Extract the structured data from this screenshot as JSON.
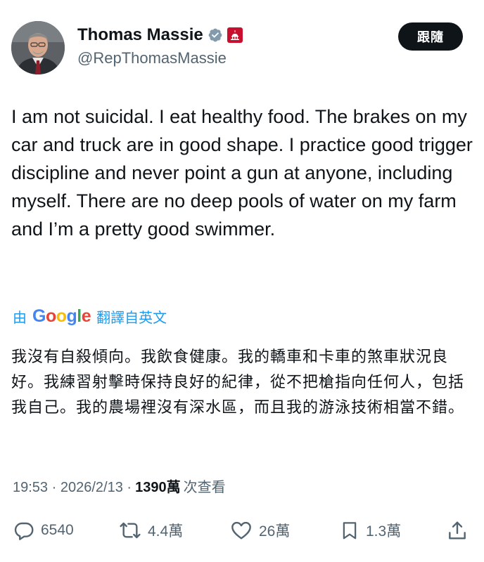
{
  "author": {
    "display_name": "Thomas Massie",
    "handle": "@RepThomasMassie"
  },
  "follow_label": "跟隨",
  "post": {
    "text": "I am not suicidal. I eat healthy food. The brakes on my car and truck are in good shape. I practice good trigger discipline and never point a gun at anyone,  including myself. There are no deep pools of water on my farm and I’m a pretty good swimmer.",
    "translation": {
      "prefix": "由",
      "provider": "Google",
      "suffix": "翻譯自英文",
      "text": "我沒有自殺傾向。我飲食健康。我的轎車和卡車的煞車狀況良好。我練習射擊時保持良好的紀律，從不把槍指向任何人，包括我自己。我的農場裡沒有深水區，而且我的游泳技術相當不錯。"
    },
    "time": "19:53",
    "separator": "·",
    "date": "2026/2/13",
    "views_count": "1390萬",
    "views_label": "次查看"
  },
  "actions": {
    "replies": "6540",
    "reposts": "4.4萬",
    "likes": "26萬",
    "bookmarks": "1.3萬"
  },
  "icons": {
    "verified": "verified-badge-icon",
    "affiliation": "capitol-affiliation-icon",
    "reply": "reply-icon",
    "repost": "repost-icon",
    "like": "heart-icon",
    "bookmark": "bookmark-icon",
    "share": "share-icon"
  },
  "colors": {
    "verified": "#829aab",
    "affiliation": "#c8102e",
    "link": "#1d9bf0",
    "muted": "#536471"
  }
}
